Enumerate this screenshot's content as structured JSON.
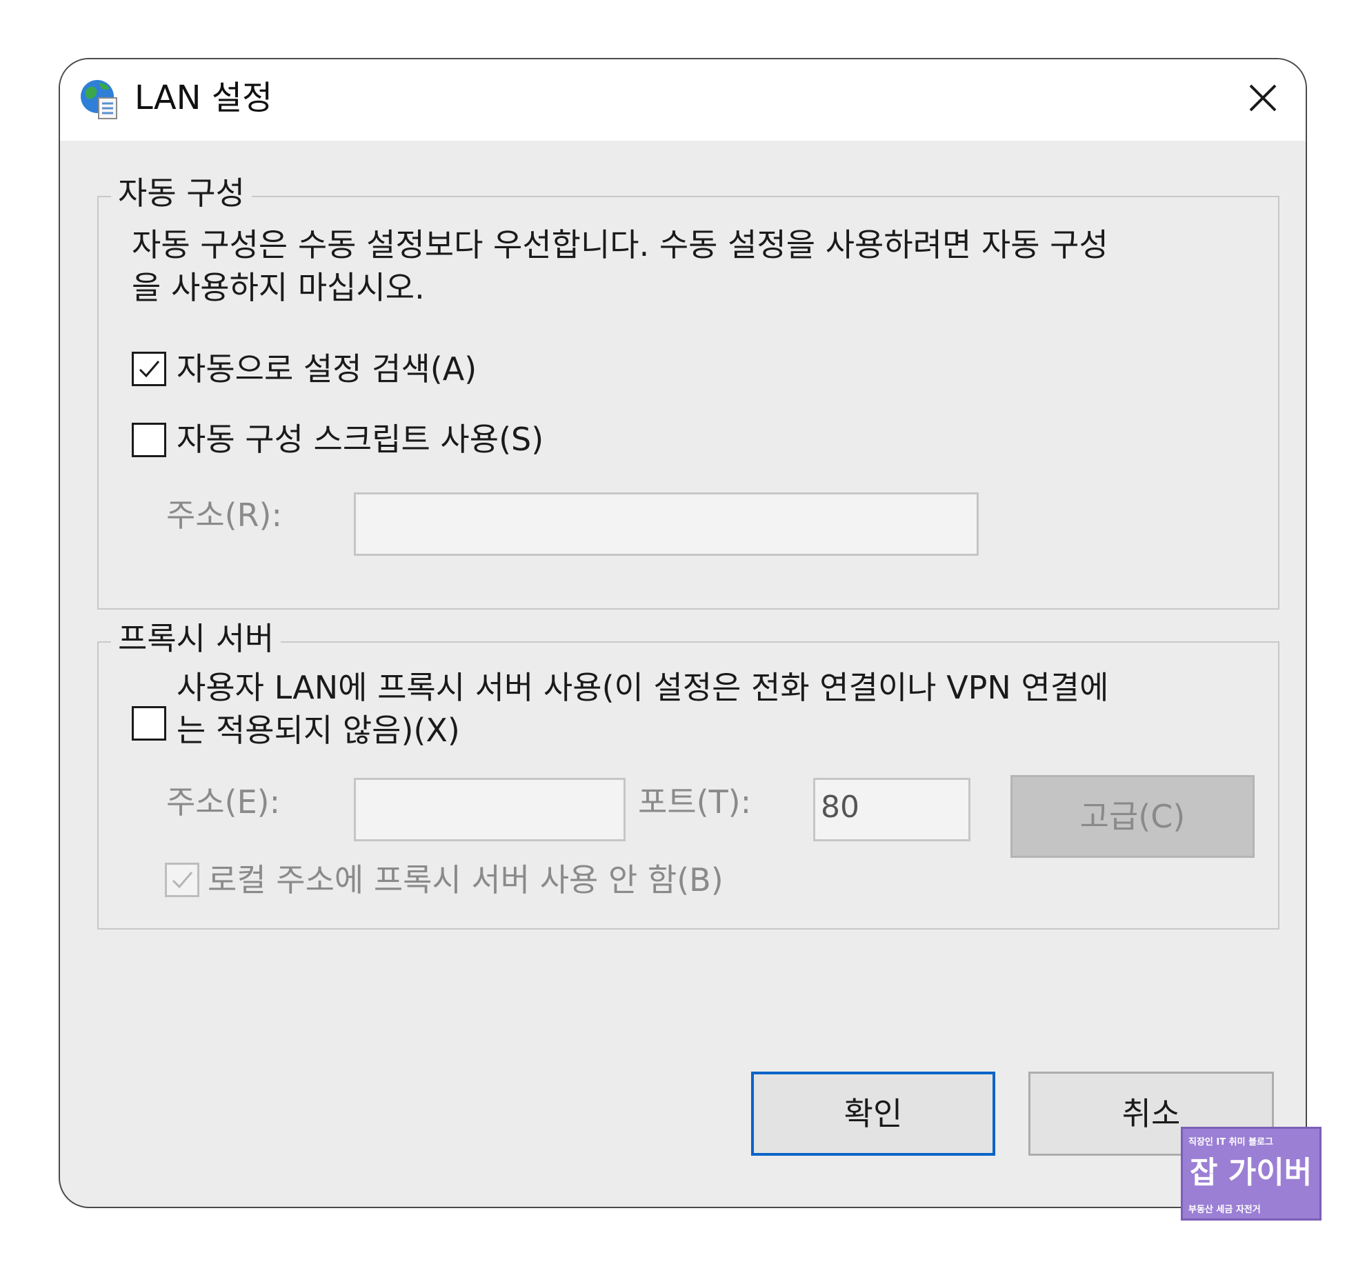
{
  "window": {
    "title": "LAN 설정",
    "close_icon": "close-icon"
  },
  "auto_config": {
    "legend": "자동 구성",
    "description_line1": "자동 구성은 수동 설정보다 우선합니다. 수동 설정을 사용하려면 자동 구성",
    "description_line2": "을 사용하지 마십시오.",
    "auto_detect": {
      "label": "자동으로 설정 검색(A)",
      "checked": true
    },
    "use_script": {
      "label": "자동 구성 스크립트 사용(S)",
      "checked": false
    },
    "address_label": "주소(R):",
    "address_value": ""
  },
  "proxy": {
    "legend": "프록시 서버",
    "use_proxy_line1": "사용자 LAN에 프록시 서버 사용(이 설정은 전화 연결이나 VPN 연결에",
    "use_proxy_line2": "는 적용되지 않음)(X)",
    "use_proxy_checked": false,
    "address_label": "주소(E):",
    "address_value": "",
    "port_label": "포트(T):",
    "port_value": "80",
    "advanced_label": "고급(C)",
    "bypass_local": {
      "label": "로컬 주소에 프록시 서버 사용 안 함(B)",
      "checked": true,
      "disabled": true
    }
  },
  "buttons": {
    "ok": "확인",
    "cancel": "취소"
  },
  "watermark": {
    "top": "직장인 IT 취미 블로그",
    "main": "잡 가이버",
    "bottom": "부동산 세금 자전거"
  },
  "colors": {
    "accent": "#0a64c8",
    "dialog_bg": "#ececec",
    "watermark_bg": "#9b7fd4"
  }
}
